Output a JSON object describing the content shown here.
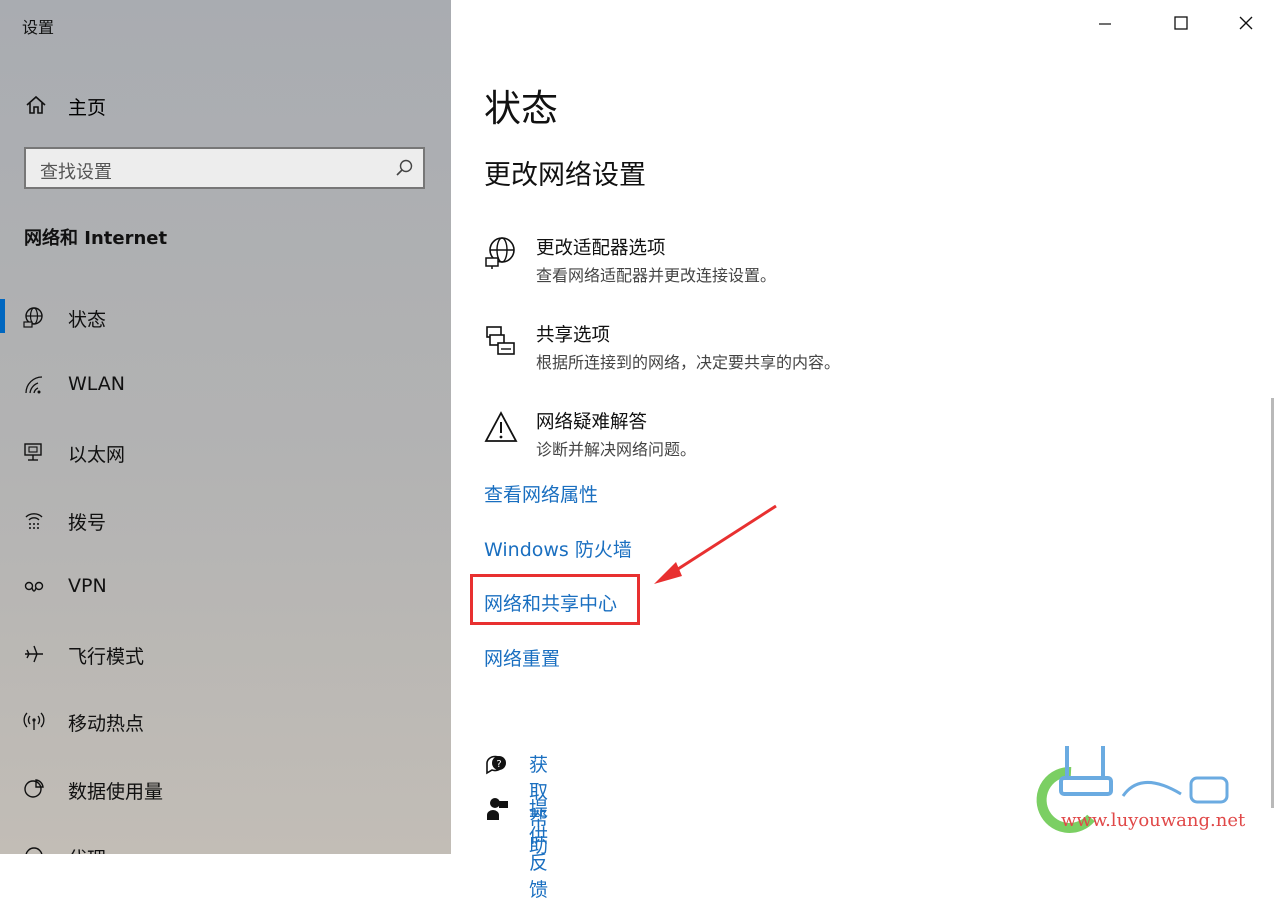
{
  "window": {
    "title": "设置"
  },
  "sidebar": {
    "home_label": "主页",
    "search_placeholder": "查找设置",
    "section_title": "网络和 Internet",
    "items": [
      {
        "label": "状态",
        "icon": "globe-icon",
        "active": true
      },
      {
        "label": "WLAN",
        "icon": "wifi-icon"
      },
      {
        "label": "以太网",
        "icon": "ethernet-icon"
      },
      {
        "label": "拨号",
        "icon": "dialup-icon"
      },
      {
        "label": "VPN",
        "icon": "vpn-icon"
      },
      {
        "label": "飞行模式",
        "icon": "airplane-icon"
      },
      {
        "label": "移动热点",
        "icon": "hotspot-icon"
      },
      {
        "label": "数据使用量",
        "icon": "data-usage-icon"
      },
      {
        "label": "代理",
        "icon": "proxy-icon"
      }
    ]
  },
  "main": {
    "title": "状态",
    "subtitle": "更改网络设置",
    "options": [
      {
        "title": "更改适配器选项",
        "desc": "查看网络适配器并更改连接设置。",
        "icon": "adapter-globe-icon"
      },
      {
        "title": "共享选项",
        "desc": "根据所连接到的网络，决定要共享的内容。",
        "icon": "sharing-icon"
      },
      {
        "title": "网络疑难解答",
        "desc": "诊断并解决网络问题。",
        "icon": "warning-icon"
      }
    ],
    "links": [
      "查看网络属性",
      "Windows 防火墙",
      "网络和共享中心",
      "网络重置"
    ],
    "help": [
      {
        "label": "获取帮助",
        "icon": "help-chat-icon"
      },
      {
        "label": "提供反馈",
        "icon": "feedback-icon"
      }
    ]
  },
  "watermark": {
    "url": "www.luyouwang.net"
  },
  "colors": {
    "accent": "#0067c0",
    "link": "#1a6fc0",
    "highlight": "#e83030"
  }
}
